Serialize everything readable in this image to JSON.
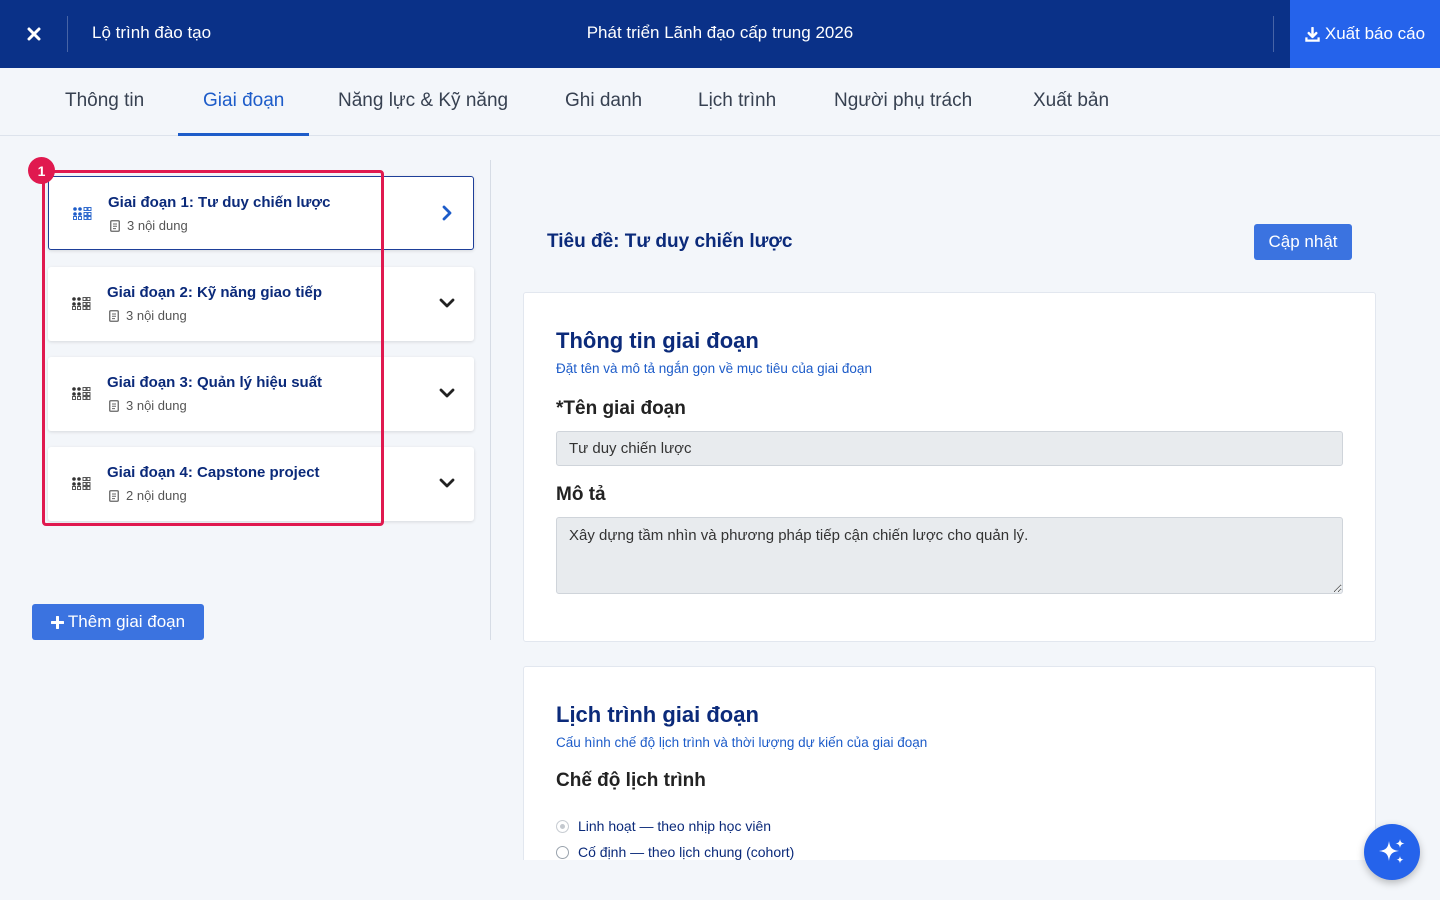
{
  "header": {
    "close_icon": "close-icon",
    "breadcrumb": "Lộ trình đào tạo",
    "program_title": "Phát triển Lãnh đạo cấp trung 2026",
    "export_label": "Xuất báo cáo",
    "export_icon": "download-icon",
    "background": "#0a3188",
    "accent": "#2563eb"
  },
  "tabs": [
    {
      "label": "Thông tin"
    },
    {
      "label": "Giai đoạn",
      "active": true
    },
    {
      "label": "Năng lực & Kỹ năng"
    },
    {
      "label": "Ghi danh"
    },
    {
      "label": "Lịch trình"
    },
    {
      "label": "Người phụ trách"
    },
    {
      "label": "Xuất bản"
    }
  ],
  "stages": [
    {
      "name": "Giai đoạn 1: Tư duy chiến lược",
      "meta": "3 nội dung",
      "active": true,
      "arrow_icon": "chevron-right-icon"
    },
    {
      "name": "Giai đoạn 2: Kỹ năng giao tiếp",
      "meta": "3 nội dung",
      "arrow_icon": "chevron-down-icon"
    },
    {
      "name": "Giai đoạn 3: Quản lý hiệu suất",
      "meta": "3 nội dung",
      "arrow_icon": "chevron-down-icon"
    },
    {
      "name": "Giai đoạn 4: Capstone project",
      "meta": "2 nội dung",
      "arrow_icon": "chevron-down-icon"
    }
  ],
  "annotation": {
    "badge": "1",
    "color": "#e0194f"
  },
  "add_stage_label": "Thêm giai đoạn",
  "detail": {
    "title": "Tiêu đề: Tư duy chiến lược",
    "update_label": "Cập nhật",
    "info_panel": {
      "title": "Thông tin giai đoạn",
      "subtitle": "Đặt tên và mô tả ngắn gọn về mục tiêu của giai đoạn",
      "name_label": "*Tên giai đoạn",
      "name_value": "Tư duy chiến lược",
      "desc_label": "Mô tả",
      "desc_value": "Xây dựng tầm nhìn và phương pháp tiếp cận chiến lược cho quản lý."
    },
    "schedule_panel": {
      "title": "Lịch trình giai đoạn",
      "subtitle": "Cấu hình chế độ lịch trình và thời lượng dự kiến của giai đoạn",
      "mode_label": "Chế độ lịch trình",
      "options": [
        {
          "label": "Linh hoạt — theo nhịp học viên",
          "selected": true
        },
        {
          "label": "Cố định — theo lịch chung (cohort)",
          "selected": false
        }
      ]
    }
  },
  "assistant_icon": "sparkle-icon"
}
